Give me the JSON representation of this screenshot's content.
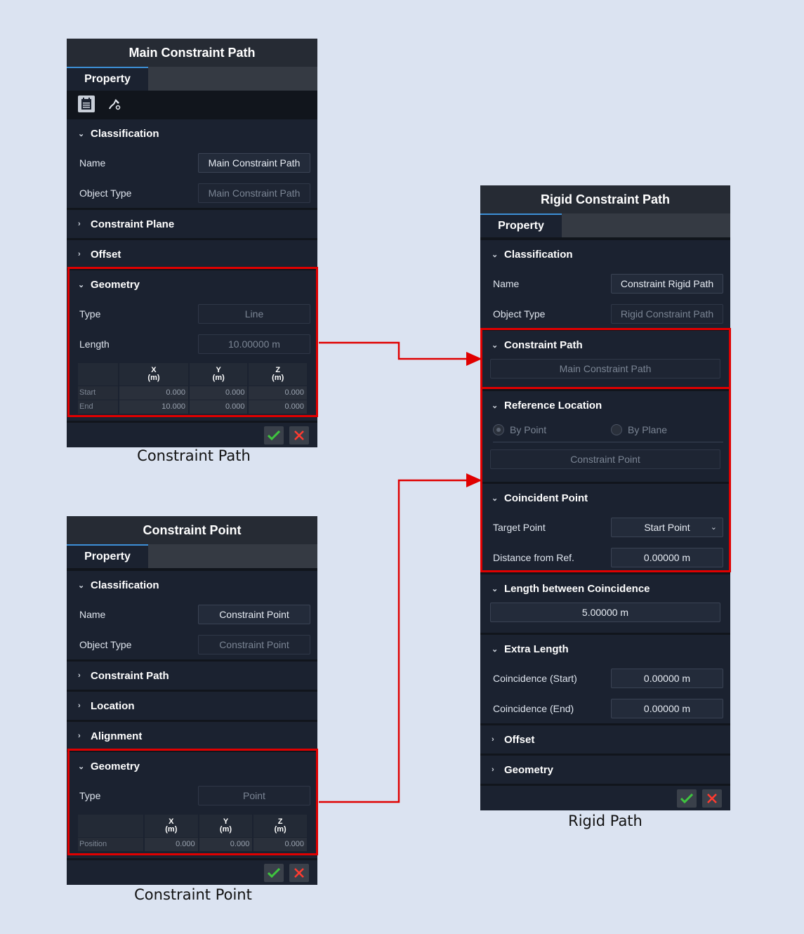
{
  "panel1": {
    "title": "Main Constraint Path",
    "tab": "Property",
    "classification": {
      "heading": "Classification",
      "name_label": "Name",
      "name_value": "Main Constraint Path",
      "type_label": "Object Type",
      "type_value": "Main Constraint Path"
    },
    "constraint_plane": "Constraint Plane",
    "offset": "Offset",
    "geometry": {
      "heading": "Geometry",
      "type_label": "Type",
      "type_value": "Line",
      "length_label": "Length",
      "length_value": "10.00000 m",
      "cols": [
        [
          "X",
          "(m)"
        ],
        [
          "Y",
          "(m)"
        ],
        [
          "Z",
          "(m)"
        ]
      ],
      "rows": [
        {
          "label": "Start",
          "x": "0.000",
          "y": "0.000",
          "z": "0.000"
        },
        {
          "label": "End",
          "x": "10.000",
          "y": "0.000",
          "z": "0.000"
        }
      ]
    },
    "caption": "Constraint Path"
  },
  "panel2": {
    "title": "Constraint Point",
    "tab": "Property",
    "classification": {
      "heading": "Classification",
      "name_label": "Name",
      "name_value": "Constraint Point",
      "type_label": "Object Type",
      "type_value": "Constraint Point"
    },
    "constraint_path": "Constraint Path",
    "location": "Location",
    "alignment": "Alignment",
    "geometry": {
      "heading": "Geometry",
      "type_label": "Type",
      "type_value": "Point",
      "cols": [
        [
          "X",
          "(m)"
        ],
        [
          "Y",
          "(m)"
        ],
        [
          "Z",
          "(m)"
        ]
      ],
      "rows": [
        {
          "label": "Position",
          "x": "0.000",
          "y": "0.000",
          "z": "0.000"
        }
      ]
    },
    "caption": "Constraint Point"
  },
  "panel3": {
    "title": "Rigid Constraint Path",
    "tab": "Property",
    "classification": {
      "heading": "Classification",
      "name_label": "Name",
      "name_value": "Constraint Rigid Path",
      "type_label": "Object Type",
      "type_value": "Rigid Constraint Path"
    },
    "constraint_path": {
      "heading": "Constraint Path",
      "value": "Main Constraint Path"
    },
    "reference_location": {
      "heading": "Reference Location",
      "by_point": "By Point",
      "by_plane": "By Plane",
      "point_value": "Constraint Point"
    },
    "coincident_point": {
      "heading": "Coincident Point",
      "target_label": "Target Point",
      "target_value": "Start Point",
      "distance_label": "Distance from Ref.",
      "distance_value": "0.00000 m"
    },
    "length_between": {
      "heading": "Length between Coincidence",
      "value": "5.00000 m"
    },
    "extra_length": {
      "heading": "Extra Length",
      "start_label": "Coincidence (Start)",
      "start_value": "0.00000 m",
      "end_label": "Coincidence (End)",
      "end_value": "0.00000 m"
    },
    "offset": "Offset",
    "geometry": "Geometry",
    "caption": "Rigid Path"
  },
  "colors": {
    "highlight": "#e00000",
    "accept": "#3fc43f",
    "cancel": "#ff3b30",
    "tab_accent": "#3d8fd6"
  },
  "icons": [
    "property-sheet-icon",
    "path-edit-icon",
    "chevron-down-icon",
    "chevron-right-icon",
    "check-icon",
    "close-icon",
    "dropdown-arrow-icon"
  ]
}
